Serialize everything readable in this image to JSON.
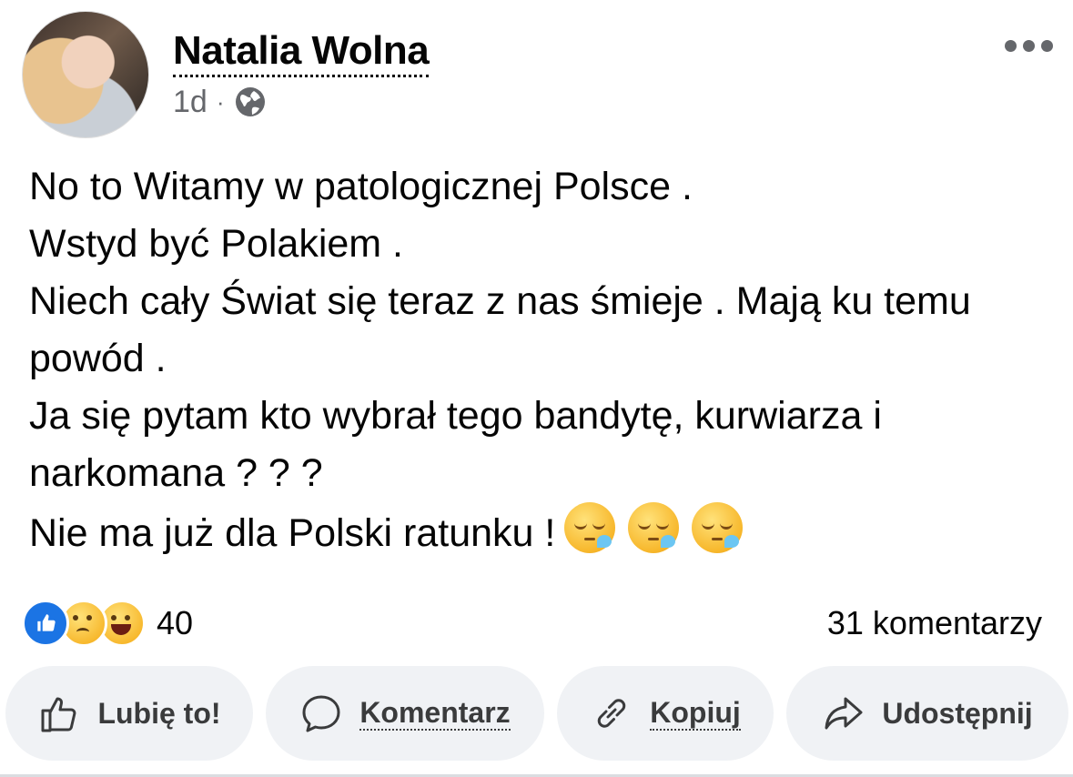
{
  "post": {
    "author": "Natalia Wolna",
    "time": "1d",
    "separator": "·",
    "privacy_icon": "globe-icon",
    "lines": [
      "No to Witamy w patologicznej Polsce .",
      "Wstyd być Polakiem .",
      "Niech cały Świat się teraz z nas śmieje . Mają ku temu powód .",
      "Ja się pytam kto wybrał tego bandytę, kurwiarza i narkomana ? ? ?",
      "Nie ma już dla Polski ratunku !"
    ],
    "emojis": [
      "sleepy-face-emoji",
      "sleepy-face-emoji",
      "sleepy-face-emoji"
    ]
  },
  "stats": {
    "reactions": [
      "like",
      "sad",
      "haha"
    ],
    "reaction_count": "40",
    "comments": "31 komentarzy"
  },
  "actions": {
    "like": "Lubię to!",
    "comment": "Komentarz",
    "copy": "Kopiuj",
    "share": "Udostępnij"
  },
  "colors": {
    "accent": "#1b74e4",
    "button_bg": "#f0f2f5",
    "secondary_text": "#65676b"
  }
}
